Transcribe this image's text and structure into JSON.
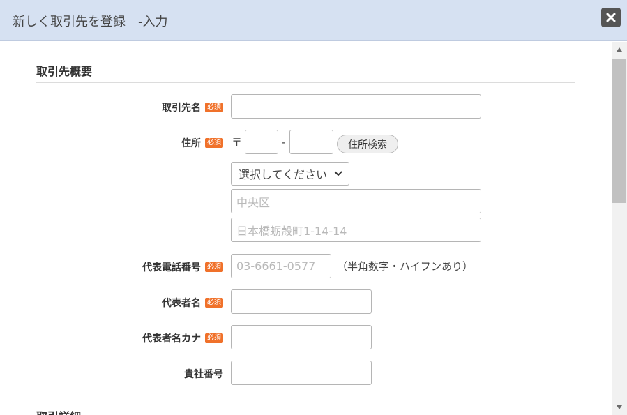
{
  "dialog": {
    "title": "新しく取引先を登録　-入力",
    "close_icon": "close-icon"
  },
  "section1": {
    "title": "取引先概要"
  },
  "section2": {
    "title": "取引詳細"
  },
  "required_badge": "必須",
  "fields": {
    "company_name": {
      "label": "取引先名",
      "value": ""
    },
    "address": {
      "label": "住所",
      "zip_mark": "〒",
      "zip_dash": "-",
      "zip1": "",
      "zip2": "",
      "search_button": "住所検索",
      "prefecture_selected": "選択してください",
      "city_placeholder": "中央区",
      "street_placeholder": "日本橋蛎殻町1-14-14"
    },
    "phone": {
      "label": "代表電話番号",
      "placeholder": "03-6661-0577",
      "hint": "（半角数字・ハイフンあり）"
    },
    "rep_name": {
      "label": "代表者名",
      "value": ""
    },
    "rep_kana": {
      "label": "代表者名カナ",
      "value": ""
    },
    "corp_number": {
      "label": "貴社番号",
      "value": ""
    }
  },
  "colors": {
    "header_bg": "#d6e1f2",
    "required_badge": "#f0712a"
  }
}
